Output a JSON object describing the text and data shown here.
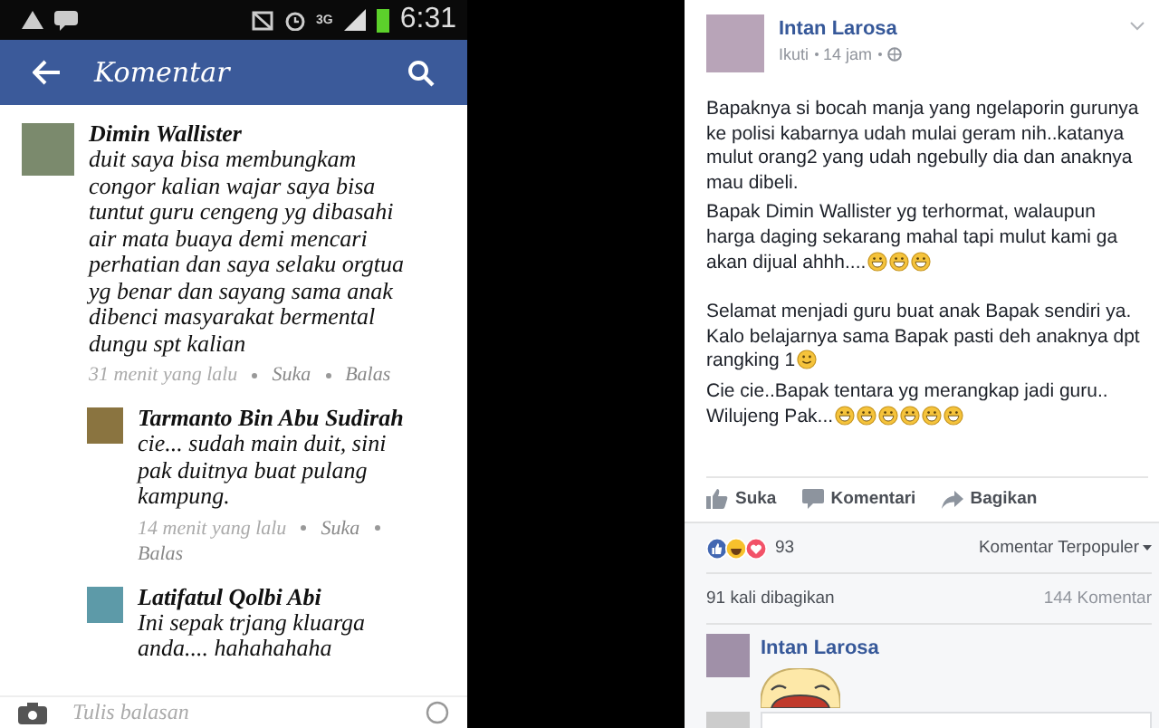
{
  "phone": {
    "status_bar": {
      "network": "3G",
      "time": "6:31"
    },
    "header": {
      "title": "Komentar"
    },
    "comments": [
      {
        "author": "Dimin Wallister",
        "text": "duit saya bisa membungkam congor kalian wajar saya bisa tuntut guru cengeng yg dibasahi air mata buaya demi mencari perhatian dan saya selaku orgtua yg benar dan sayang sama anak dibenci masyarakat bermental dungu spt kalian",
        "time": "31 menit yang lalu",
        "like": "Suka",
        "reply": "Balas",
        "reply_level": false
      },
      {
        "author": "Tarmanto Bin Abu Sudirah",
        "text": "cie... sudah main duit,  sini pak duitnya buat pulang kampung.",
        "time": "14 menit yang lalu",
        "like": "Suka",
        "reply": "Balas",
        "reply_level": true
      },
      {
        "author": "Latifatul Qolbi Abi",
        "text": "Ini sepak trjang kluarga anda.... hahahahaha",
        "reply_level": true
      }
    ],
    "composer": {
      "placeholder": "Tulis balasan"
    }
  },
  "post": {
    "author": "Intan Larosa",
    "follow": "Ikuti",
    "time": "14 jam",
    "paragraphs": [
      {
        "text": "Bapaknya si bocah manja yang ngelaporin gurunya ke polisi kabarnya udah mulai geram nih..katanya mulut orang2 yang udah ngebully dia dan anaknya mau dibeli.",
        "gap_after": false
      },
      {
        "text": "Bapak Dimin Wallister yg terhormat, walaupun harga daging sekarang mahal tapi mulut kami ga akan dijual ahhh....",
        "emoji": [
          {
            "kind": "grin"
          },
          {
            "kind": "grin"
          },
          {
            "kind": "grin"
          }
        ],
        "gap_after": true
      },
      {
        "text": "Selamat menjadi guru buat anak Bapak sendiri ya. Kalo belajarnya sama Bapak pasti deh anaknya dpt rangking 1",
        "emoji": [
          {
            "kind": "smile"
          }
        ],
        "gap_after": false
      },
      {
        "text": "Cie cie..Bapak tentara yg merangkap jadi guru.. Wilujeng Pak...",
        "emoji": [
          {
            "kind": "grin"
          },
          {
            "kind": "grin"
          },
          {
            "kind": "grin"
          },
          {
            "kind": "grin"
          },
          {
            "kind": "grin"
          },
          {
            "kind": "grin"
          }
        ],
        "gap_after": false
      }
    ],
    "actions": [
      {
        "kind": "like",
        "label": "Suka"
      },
      {
        "kind": "comment",
        "label": "Komentari"
      },
      {
        "kind": "share",
        "label": "Bagikan"
      }
    ],
    "reactions_count": "93",
    "sort": "Komentar Terpopuler",
    "shares": "91 kali dibagikan",
    "comments_count": "144 Komentar",
    "comment": {
      "author": "Intan Larosa"
    }
  }
}
